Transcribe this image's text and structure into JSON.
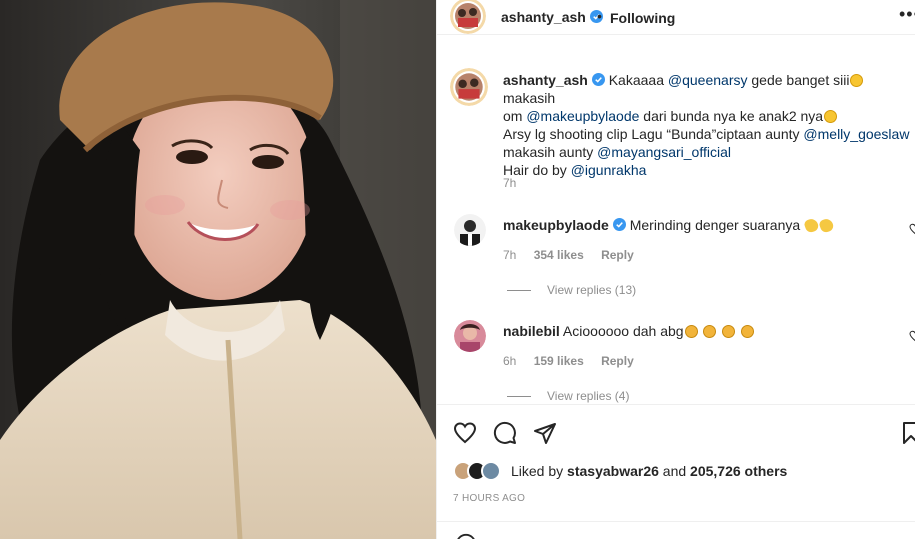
{
  "header": {
    "username": "ashanty_ash",
    "separator": "•",
    "follow_label": "Following",
    "more_label": "•••"
  },
  "caption": {
    "username": "ashanty_ash",
    "line1_a": "Kakaaaa",
    "mention1": "@queenarsy",
    "line1_b": "gede banget siii",
    "line1_c": "makasih",
    "line2_a": "om",
    "mention2": "@makeupbylaode",
    "line2_b": "dari bunda nya ke anak2 nya",
    "line3_a": "Arsy lg shooting clip Lagu “Bunda”ciptaan aunty",
    "mention3": "@melly_goeslaw",
    "line4_a": "makasih aunty",
    "mention4": "@mayangsari_official",
    "line5_a": "Hair do by",
    "mention5": "@igunrakha",
    "time": "7h"
  },
  "comments": [
    {
      "username": "makeupbylaode",
      "text": "Merinding denger suaranya",
      "time": "7h",
      "likes": "354 likes",
      "reply_label": "Reply",
      "view_replies": "View replies (13)"
    },
    {
      "username": "nabilebil",
      "text": "Acioooooo dah abg",
      "time": "6h",
      "likes": "159 likes",
      "reply_label": "Reply",
      "view_replies": "View replies (4)"
    }
  ],
  "actions": {
    "liked_prefix": "Liked by",
    "liked_user": "stasyabwar26",
    "liked_and": "and",
    "liked_count": "205,726 others",
    "time_ago": "7 HOURS AGO"
  },
  "icons": {
    "like": "heart-outline-icon",
    "comment": "comment-bubble-icon",
    "share": "paper-plane-icon",
    "save": "bookmark-icon",
    "verified": "verified-badge-icon"
  },
  "colors": {
    "text": "#262626",
    "secondary": "#8e8e8e",
    "link": "#00376b",
    "verified": "#3897f0",
    "border": "#efefef"
  }
}
